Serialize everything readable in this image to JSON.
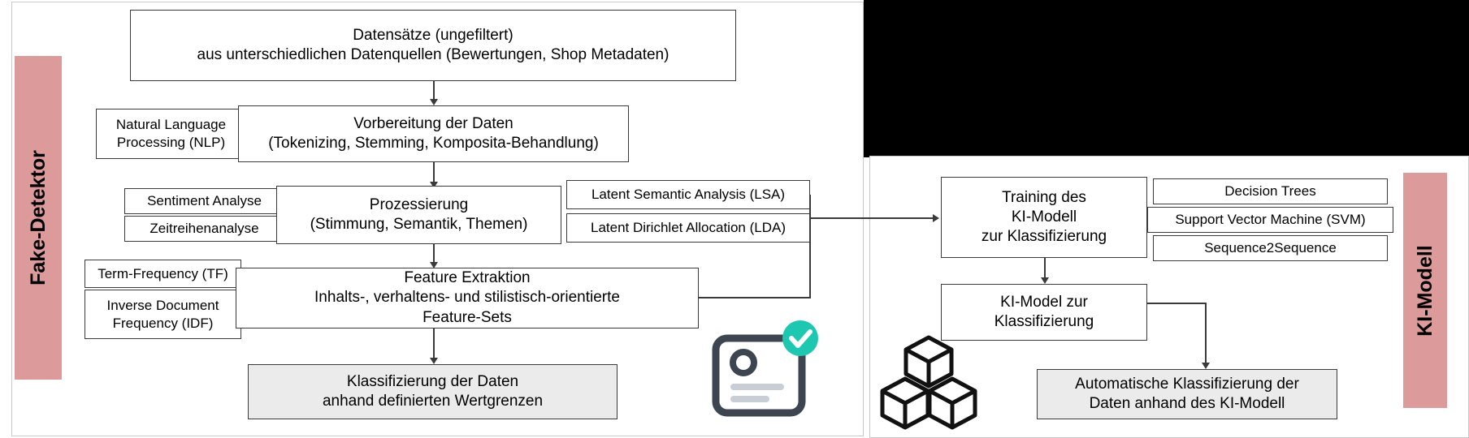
{
  "diagram": {
    "title_left_side": "Fake-Detektor",
    "title_right_side": "KI-Modell",
    "left_flow": {
      "datasets": {
        "line1": "Datensätze (ungefiltert)",
        "line2": "aus unterschiedlichen Datenquellen (Bewertungen, Shop Metadaten)"
      },
      "preparation": {
        "line1": "Vorbereitung der Daten",
        "line2": "(Tokenizing, Stemming, Komposita-Behandlung)"
      },
      "processing": {
        "line1": "Prozessierung",
        "line2": "(Stimmung, Semantik, Themen)"
      },
      "feature_extraction": {
        "line1": "Feature Extraktion",
        "line2": "Inhalts-, verhaltens- und stilistisch-orientierte",
        "line3": "Feature-Sets"
      },
      "classification": {
        "line1": "Klassifizierung der Daten",
        "line2": "anhand definierten Wertgrenzen"
      }
    },
    "left_side_boxes": {
      "nlp": {
        "line1": "Natural Language",
        "line2": "Processing (NLP)"
      },
      "sentiment": {
        "line1": "Sentiment Analyse"
      },
      "timeseries": {
        "line1": "Zeitreihenanalyse"
      },
      "tf": {
        "line1": "Term-Frequency (TF)"
      },
      "idf": {
        "line1": "Inverse Document",
        "line2": "Frequency (IDF)"
      }
    },
    "right_attached_boxes": {
      "lsa": {
        "line1": "Latent Semantic Analysis (LSA)"
      },
      "lda": {
        "line1": "Latent Dirichlet Allocation (LDA)"
      }
    },
    "right_flow": {
      "training": {
        "line1": "Training des",
        "line2": "KI-Modell",
        "line3": "zur Klassifizierung"
      },
      "model": {
        "line1": "KI-Model zur",
        "line2": "Klassifizierung"
      },
      "auto_classification": {
        "line1": "Automatische Klassifizierung der",
        "line2": "Daten anhand des KI-Modell"
      },
      "methods": {
        "decision_trees": "Decision Trees",
        "svm": "Support Vector Machine (SVM)",
        "seq2seq": "Sequence2Sequence"
      }
    },
    "icons": {
      "id_card": "id-card-check-icon",
      "cubes": "cubes-icon",
      "check_badge": "check-badge-icon"
    },
    "colors": {
      "side_label_bg": "#dd9a9a",
      "box_border": "#3a3a3a",
      "shaded_box_bg": "#ebebeb",
      "check_badge": "#1ec8b0",
      "panel_border": "#c9c9c9"
    }
  }
}
